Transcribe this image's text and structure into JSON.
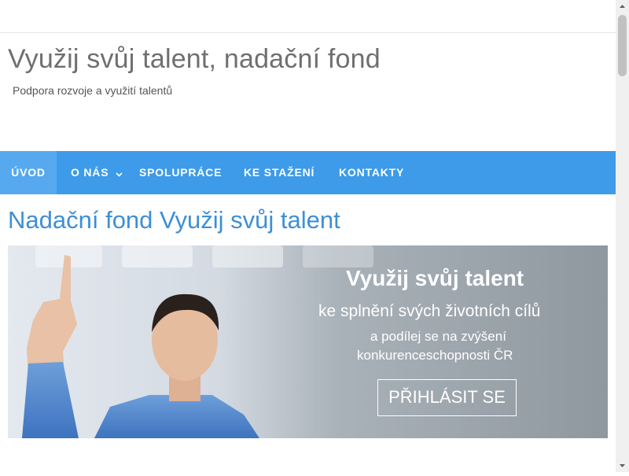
{
  "header": {
    "site_title": "Využij svůj talent, nadační fond",
    "tagline": "Podpora rozvoje a využití talentů"
  },
  "nav": {
    "items": [
      {
        "label": "ÚVOD",
        "active": true
      },
      {
        "label": "O NÁS",
        "has_dropdown": true
      },
      {
        "label": "SPOLUPRÁCE"
      },
      {
        "label": "KE STAŽENÍ"
      },
      {
        "label": "KONTAKTY"
      }
    ],
    "dropdown_icon": "chevron-down-icon"
  },
  "main": {
    "page_title": "Nadační fond Využij svůj talent"
  },
  "banner": {
    "heading": "Využij svůj talent",
    "line1": "ke splnění svých životních cílů",
    "line2": "a podílej se na zvýšení",
    "line3": "konkurenceschopnosti ČR",
    "button_label": "PŘIHLÁSIT SE"
  },
  "colors": {
    "nav_background": "#3d9be9",
    "nav_active": "#57a9ef",
    "page_title": "#3d8fd6",
    "site_title": "#6f6f6f"
  }
}
